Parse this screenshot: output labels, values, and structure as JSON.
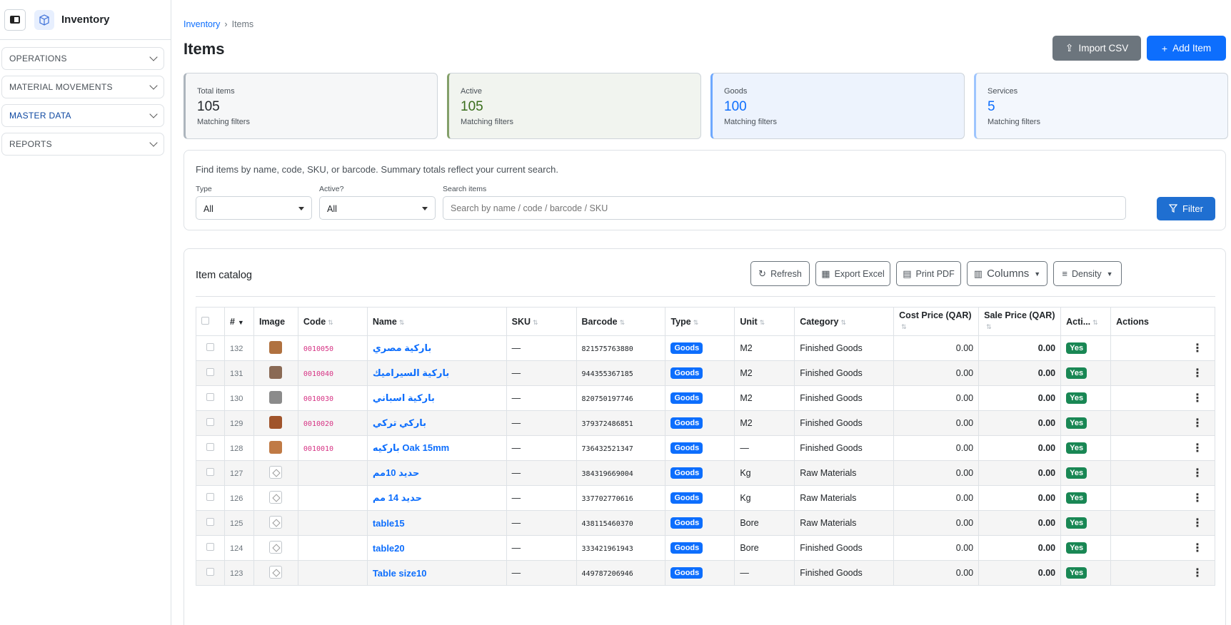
{
  "app": {
    "title": "Inventory"
  },
  "sidebar": {
    "items": [
      {
        "label": "OPERATIONS"
      },
      {
        "label": "MATERIAL MOVEMENTS"
      },
      {
        "label": "MASTER DATA"
      },
      {
        "label": "REPORTS"
      }
    ]
  },
  "breadcrumb": {
    "parent": "Inventory",
    "sep": "›",
    "current": "Items"
  },
  "page": {
    "title": "Items"
  },
  "toolbar": {
    "import_label": "Import CSV",
    "add_label": "Add Item"
  },
  "cards": [
    {
      "label": "Total items",
      "value": "105",
      "sub": "Matching filters"
    },
    {
      "label": "Active",
      "value": "105",
      "sub": "Matching filters"
    },
    {
      "label": "Goods",
      "value": "100",
      "sub": "Matching filters"
    },
    {
      "label": "Services",
      "value": "5",
      "sub": "Matching filters"
    }
  ],
  "filters": {
    "hint": "Find items by name, code, SKU, or barcode. Summary totals reflect your current search.",
    "type_label": "Type",
    "type_value": "All",
    "active_label": "Active?",
    "active_value": "All",
    "search_label": "Search items",
    "search_placeholder": "Search by name / code / barcode / SKU",
    "filter_button": "Filter"
  },
  "catalog": {
    "title": "Item catalog",
    "refresh": "Refresh",
    "export_excel": "Export Excel",
    "print_pdf": "Print PDF",
    "columns": "Columns",
    "density": "Density",
    "headers": {
      "num": "#",
      "image": "Image",
      "code": "Code",
      "name": "Name",
      "sku": "SKU",
      "barcode": "Barcode",
      "type": "Type",
      "unit": "Unit",
      "category": "Category",
      "cost": "Cost Price (QAR)",
      "sale": "Sale Price (QAR)",
      "active": "Acti...",
      "actions": "Actions"
    },
    "rows": [
      {
        "num": "132",
        "code": "0010050",
        "name": "باركية مصري",
        "sku": "—",
        "barcode": "821575763880",
        "type": "Goods",
        "unit": "M2",
        "category": "Finished Goods",
        "cost": "0.00",
        "sale": "0.00",
        "active": "Yes",
        "thumb": "photo"
      },
      {
        "num": "131",
        "code": "0010040",
        "name": "باركية السيراميك",
        "sku": "—",
        "barcode": "944355367185",
        "type": "Goods",
        "unit": "M2",
        "category": "Finished Goods",
        "cost": "0.00",
        "sale": "0.00",
        "active": "Yes",
        "thumb": "photo"
      },
      {
        "num": "130",
        "code": "0010030",
        "name": "باركية اسباني",
        "sku": "—",
        "barcode": "820750197746",
        "type": "Goods",
        "unit": "M2",
        "category": "Finished Goods",
        "cost": "0.00",
        "sale": "0.00",
        "active": "Yes",
        "thumb": "photo"
      },
      {
        "num": "129",
        "code": "0010020",
        "name": "باركي تركي",
        "sku": "—",
        "barcode": "379372486851",
        "type": "Goods",
        "unit": "M2",
        "category": "Finished Goods",
        "cost": "0.00",
        "sale": "0.00",
        "active": "Yes",
        "thumb": "photo"
      },
      {
        "num": "128",
        "code": "0010010",
        "name": "باركيه Oak 15mm",
        "sku": "—",
        "barcode": "736432521347",
        "type": "Goods",
        "unit": "—",
        "category": "Finished Goods",
        "cost": "0.00",
        "sale": "0.00",
        "active": "Yes",
        "thumb": "photo"
      },
      {
        "num": "127",
        "code": "",
        "name": "حديد 10مم",
        "sku": "—",
        "barcode": "384319669004",
        "type": "Goods",
        "unit": "Kg",
        "category": "Raw Materials",
        "cost": "0.00",
        "sale": "0.00",
        "active": "Yes",
        "thumb": "placeholder"
      },
      {
        "num": "126",
        "code": "",
        "name": "حديد 14 مم",
        "sku": "—",
        "barcode": "337702770616",
        "type": "Goods",
        "unit": "Kg",
        "category": "Raw Materials",
        "cost": "0.00",
        "sale": "0.00",
        "active": "Yes",
        "thumb": "placeholder"
      },
      {
        "num": "125",
        "code": "",
        "name": "table15",
        "sku": "—",
        "barcode": "438115460370",
        "type": "Goods",
        "unit": "Bore",
        "category": "Raw Materials",
        "cost": "0.00",
        "sale": "0.00",
        "active": "Yes",
        "thumb": "placeholder"
      },
      {
        "num": "124",
        "code": "",
        "name": "table20",
        "sku": "—",
        "barcode": "333421961943",
        "type": "Goods",
        "unit": "Bore",
        "category": "Finished Goods",
        "cost": "0.00",
        "sale": "0.00",
        "active": "Yes",
        "thumb": "placeholder"
      },
      {
        "num": "123",
        "code": "",
        "name": "Table size10",
        "sku": "—",
        "barcode": "449787206946",
        "type": "Goods",
        "unit": "—",
        "category": "Finished Goods",
        "cost": "0.00",
        "sale": "0.00",
        "active": "Yes",
        "thumb": "placeholder"
      }
    ]
  },
  "colors": {
    "primary": "#0d6efd",
    "secondary": "#6c757d",
    "success": "#198754",
    "code_pink": "#d63384"
  }
}
